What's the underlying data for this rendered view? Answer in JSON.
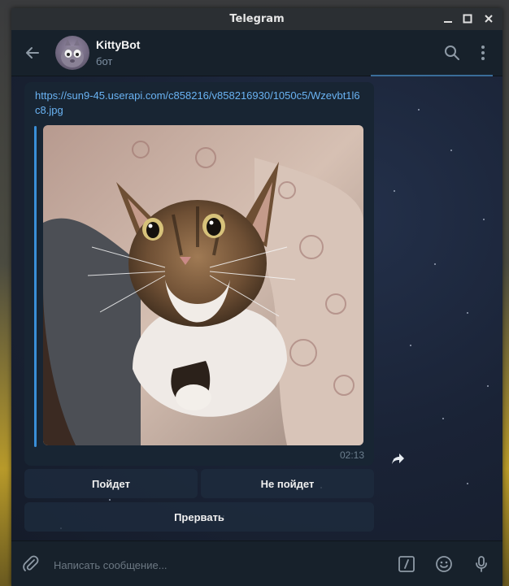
{
  "window": {
    "title": "Telegram"
  },
  "chat": {
    "name": "KittyBot",
    "status": "бот"
  },
  "message": {
    "link": "https://sun9-45.userapi.com/c858216/v858216930/1050c5/Wzevbt1l6c8.jpg",
    "time": "02:13",
    "photo": "cat-photo"
  },
  "keyboard": {
    "rows": [
      [
        "Пойдет",
        "Не пойдет"
      ],
      [
        "Прервать"
      ]
    ]
  },
  "composer": {
    "placeholder": "Написать сообщение..."
  },
  "icons": {
    "back": "arrow-left-icon",
    "search": "search-icon",
    "menu": "more-vertical-icon",
    "forward": "share-icon",
    "attach": "paperclip-icon",
    "commands": "slash-commands-icon",
    "emoji": "emoji-icon",
    "mic": "microphone-icon"
  },
  "colors": {
    "link": "#6ab3f3",
    "accent": "#3a8fd8",
    "bubble": "#182533",
    "header": "#17212b"
  }
}
